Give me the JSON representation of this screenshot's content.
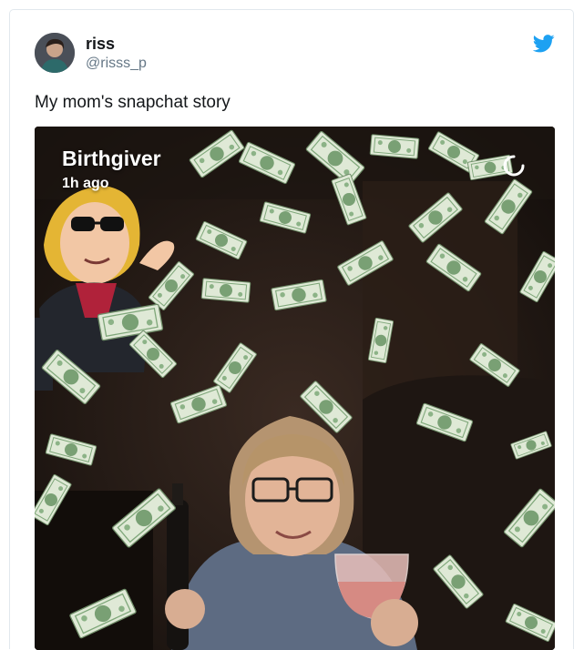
{
  "tweet": {
    "display_name": "riss",
    "handle": "@risss_p",
    "text": "My mom's snapchat story",
    "brand_icon": "twitter-bird-icon",
    "brand_color": "#1da1f2"
  },
  "snap": {
    "title": "Birthgiver",
    "time_ago": "1h ago",
    "loader_icon": "loading-spinner-icon"
  }
}
